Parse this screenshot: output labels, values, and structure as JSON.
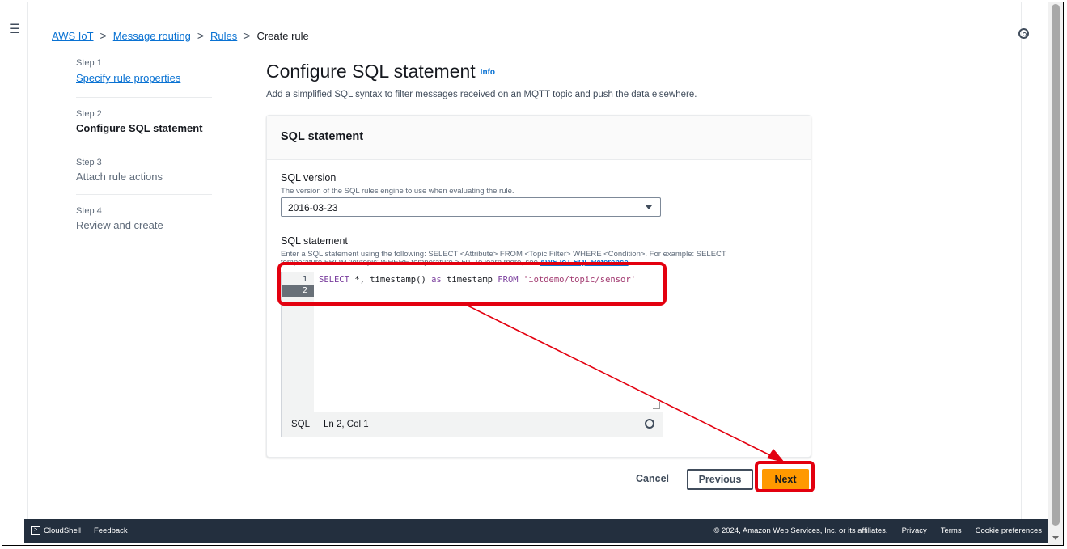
{
  "breadcrumb": {
    "items": [
      "AWS IoT",
      "Message routing",
      "Rules"
    ],
    "current": "Create rule"
  },
  "steps": [
    {
      "num": "Step 1",
      "label": "Specify rule properties"
    },
    {
      "num": "Step 2",
      "label": "Configure SQL statement"
    },
    {
      "num": "Step 3",
      "label": "Attach rule actions"
    },
    {
      "num": "Step 4",
      "label": "Review and create"
    }
  ],
  "header": {
    "title": "Configure SQL statement",
    "info": "Info",
    "description": "Add a simplified SQL syntax to filter messages received on an MQTT topic and push the data elsewhere."
  },
  "panel": {
    "title": "SQL statement",
    "version_label": "SQL version",
    "version_desc": "The version of the SQL rules engine to use when evaluating the rule.",
    "version_value": "2016-03-23",
    "statement_label": "SQL statement",
    "statement_desc": "Enter a SQL statement using the following: SELECT <Attribute> FROM <Topic Filter> WHERE <Condition>. For example: SELECT",
    "statement_desc2": "temperature FROM 'iot/topic' WHERE temperature > 50. To learn more, see",
    "reference_link": "AWS IoT SQL Reference",
    "editor": {
      "line_numbers": [
        "1",
        "2"
      ],
      "code_select": "SELECT",
      "code_mid": " *, timestamp() ",
      "code_as": "as",
      "code_ts": " timestamp ",
      "code_from": "FROM",
      "code_topic": "'iotdemo/topic/sensor'",
      "language": "SQL",
      "cursor_pos": "Ln 2, Col 1"
    }
  },
  "actions": {
    "cancel": "Cancel",
    "previous": "Previous",
    "next": "Next"
  },
  "footer": {
    "cloudshell": "CloudShell",
    "feedback": "Feedback",
    "copyright": "© 2024, Amazon Web Services, Inc. or its affiliates.",
    "privacy": "Privacy",
    "terms": "Terms",
    "cookies": "Cookie preferences"
  },
  "colors": {
    "annotation": "#e3000f",
    "primary_button": "#ff9900",
    "link": "#0972d3"
  }
}
